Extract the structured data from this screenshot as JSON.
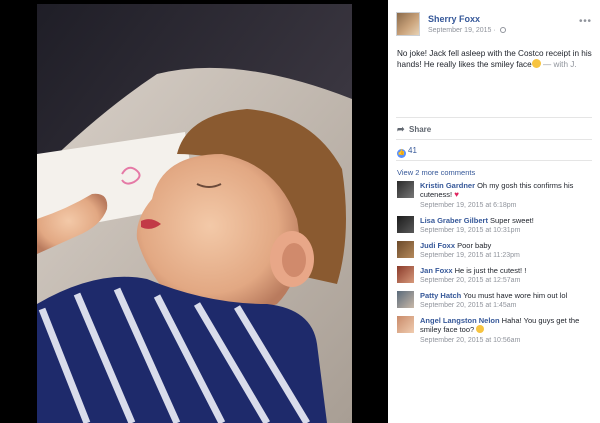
{
  "post": {
    "author": "Sherry Foxx",
    "date": "September 19, 2015 · ",
    "text": "No joke! Jack fell asleep with the Costco receipt in his hands! He really likes the smiley face",
    "with_tag": " — with J."
  },
  "actions": {
    "share_label": "Share"
  },
  "reactions": {
    "count": "41"
  },
  "comments_section": {
    "view_more": "View 2 more comments",
    "comments": [
      {
        "name": "Kristin Gardner",
        "text": " Oh my gosh this confirms his cuteness! ",
        "time": "September 19, 2015 at 6:18pm"
      },
      {
        "name": "Lisa Graber Gilbert",
        "text": " Super sweet!",
        "time": "September 19, 2015 at 10:31pm"
      },
      {
        "name": "Judi Foxx",
        "text": " Poor baby",
        "time": "September 19, 2015 at 11:23pm"
      },
      {
        "name": "Jan Foxx",
        "text": " He is just the cutest! !",
        "time": "September 20, 2015 at 12:57am"
      },
      {
        "name": "Patty Hatch",
        "text": " You must have wore him out lol",
        "time": "September 20, 2015 at 1:45am"
      },
      {
        "name": "Angel Langston Nelon",
        "text": " Haha! You guys get the smiley face too? ",
        "time": "September 20, 2015 at 10:56am"
      }
    ]
  },
  "colors": {
    "link_blue": "#365899",
    "meta_gray": "#90949c",
    "like_blue": "#5890ff",
    "heart_red": "#e0245e"
  },
  "icons": [
    "globe-icon",
    "options-icon",
    "share-icon",
    "like-icon",
    "heart-emoji",
    "smiley-emoji"
  ]
}
